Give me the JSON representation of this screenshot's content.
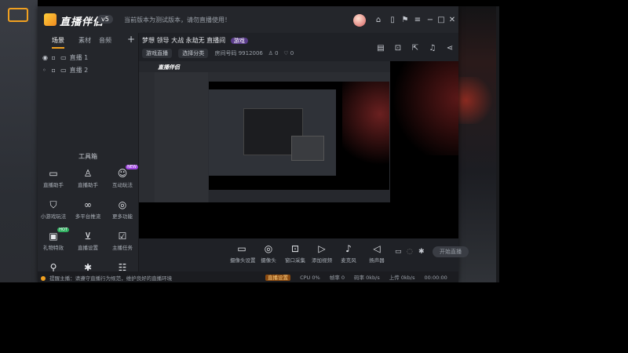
{
  "app": {
    "name": "直播伴侣",
    "version": "v5",
    "notice": "当前版本为测试版本，请勿直播使用！"
  },
  "sidebar": {
    "tabs": [
      "场景",
      "素材",
      "音频"
    ],
    "add_label": "+",
    "scenes": [
      "直播 1",
      "直播 2"
    ],
    "toolbox_title": "工具箱",
    "tools": [
      {
        "label": "直播助手",
        "icon": "chat-icon"
      },
      {
        "label": "直播助手",
        "icon": "person-icon"
      },
      {
        "label": "互动玩法",
        "icon": "game-icon",
        "badge": "NEW"
      },
      {
        "label": "小游戏玩法",
        "icon": "shield-icon"
      },
      {
        "label": "多平台推流",
        "icon": "broadcast-icon"
      },
      {
        "label": "更多功能",
        "icon": "target-icon"
      },
      {
        "label": "礼物特效",
        "icon": "gift-icon",
        "badge": "HOT"
      },
      {
        "label": "直播设置",
        "icon": "download-icon"
      },
      {
        "label": "主播任务",
        "icon": "check-icon"
      }
    ]
  },
  "room": {
    "title": "梦想 领导 大战 永劫无 直播间",
    "badge": "游戏",
    "category": "游戏直播",
    "chip2": "选择分类",
    "room_label": "房间号码",
    "room_id": "9912006",
    "stat1": "0",
    "stat2": "0"
  },
  "nested_window": {
    "logo": "直播伴侣"
  },
  "controls": [
    {
      "label": "摄像头设置",
      "icon": "monitor-icon"
    },
    {
      "label": "摄像头",
      "icon": "camera-icon"
    },
    {
      "label": "窗口采集",
      "icon": "window-icon"
    },
    {
      "label": "添加视频",
      "icon": "play-icon"
    },
    {
      "label": "麦克风",
      "icon": "mic-icon"
    },
    {
      "label": "扬声器",
      "icon": "speaker-icon"
    }
  ],
  "live_button": "开始直播",
  "status": {
    "message": "提醒主播：请遵守直播行为规范，维护良好的直播环境",
    "perf_tag": "直播设置",
    "cpu": "CPU 0%",
    "fps": "帧率 0",
    "bitrate": "码率 0kb/s",
    "upload": "上传 0kb/s",
    "time": "00:00:00"
  }
}
